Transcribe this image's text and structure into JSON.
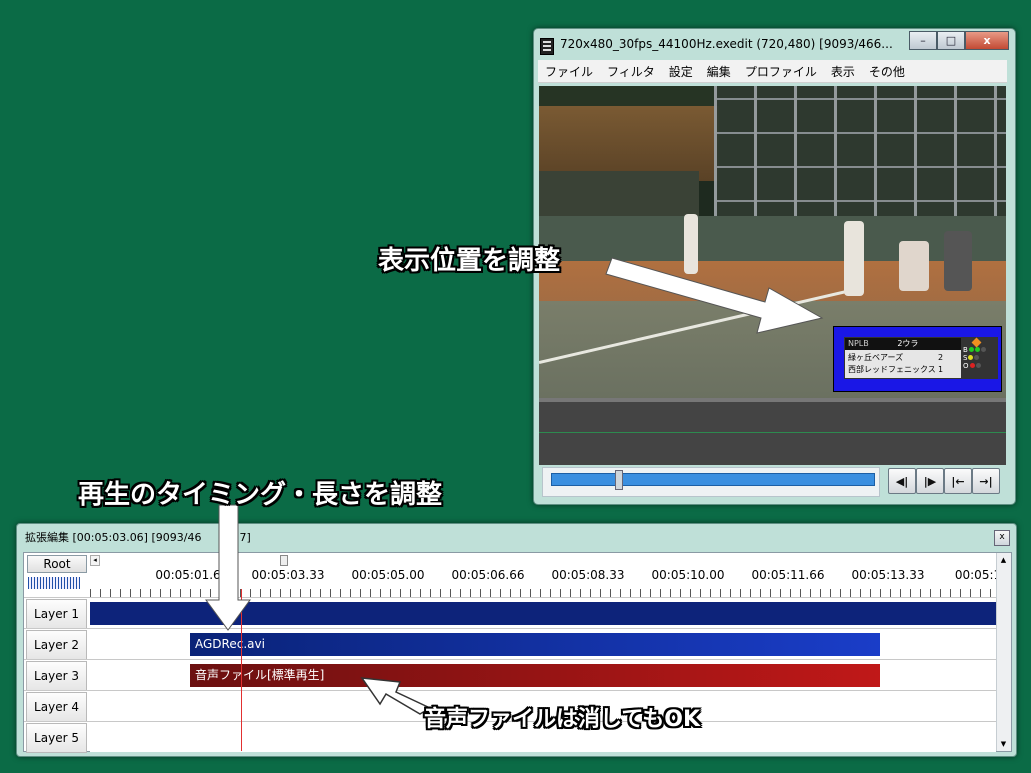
{
  "preview_window": {
    "title": "720x480_30fps_44100Hz.exedit (720,480)  [9093/466...",
    "controls": {
      "minimize": "–",
      "maximize": "□",
      "close": "x"
    },
    "menu": [
      "ファイル",
      "フィルタ",
      "設定",
      "編集",
      "プロファイル",
      "表示",
      "その他"
    ],
    "scoreboard": {
      "header_left": "NPLB",
      "inning": "2ウラ",
      "team1": "緑ヶ丘ベアーズ",
      "score1": "2",
      "team2": "西部レッドフェニックス",
      "score2": "1",
      "bso": [
        "B",
        "S",
        "O"
      ]
    },
    "playback": {
      "prev_frame": "◀|",
      "next_frame": "|▶",
      "to_start": "|←",
      "to_end": "→|"
    }
  },
  "timeline_window": {
    "title": "拡張編集 [00:05:03.06] [9093/46",
    "title_tail": "7]",
    "close": "x",
    "root_button": "Root",
    "scroll_left": "◂",
    "scroll_up": "▲",
    "scroll_down": "▼",
    "ruler": [
      "00:05:01.6",
      "00:05:03.33",
      "00:05:05.00",
      "00:05:06.66",
      "00:05:08.33",
      "00:05:10.00",
      "00:05:11.66",
      "00:05:13.33",
      "00:05:1"
    ],
    "layers": [
      {
        "label": "Layer  1",
        "clip": ""
      },
      {
        "label": "Layer  2",
        "clip": "AGDRec.avi"
      },
      {
        "label": "Layer  3",
        "clip": "音声ファイル[標準再生]"
      },
      {
        "label": "Layer  4",
        "clip": ""
      },
      {
        "label": "Layer  5",
        "clip": ""
      }
    ]
  },
  "annotations": {
    "position": "表示位置を調整",
    "timing": "再生のタイミング・長さを調整",
    "audio_note": "音声ファイルは消してもOK"
  },
  "colors": {
    "background": "#0b6b46",
    "video_clip": "#1a3dc8",
    "audio_clip": "#c01818",
    "scene_clip": "#0d237a",
    "playhead": "#e23030"
  }
}
